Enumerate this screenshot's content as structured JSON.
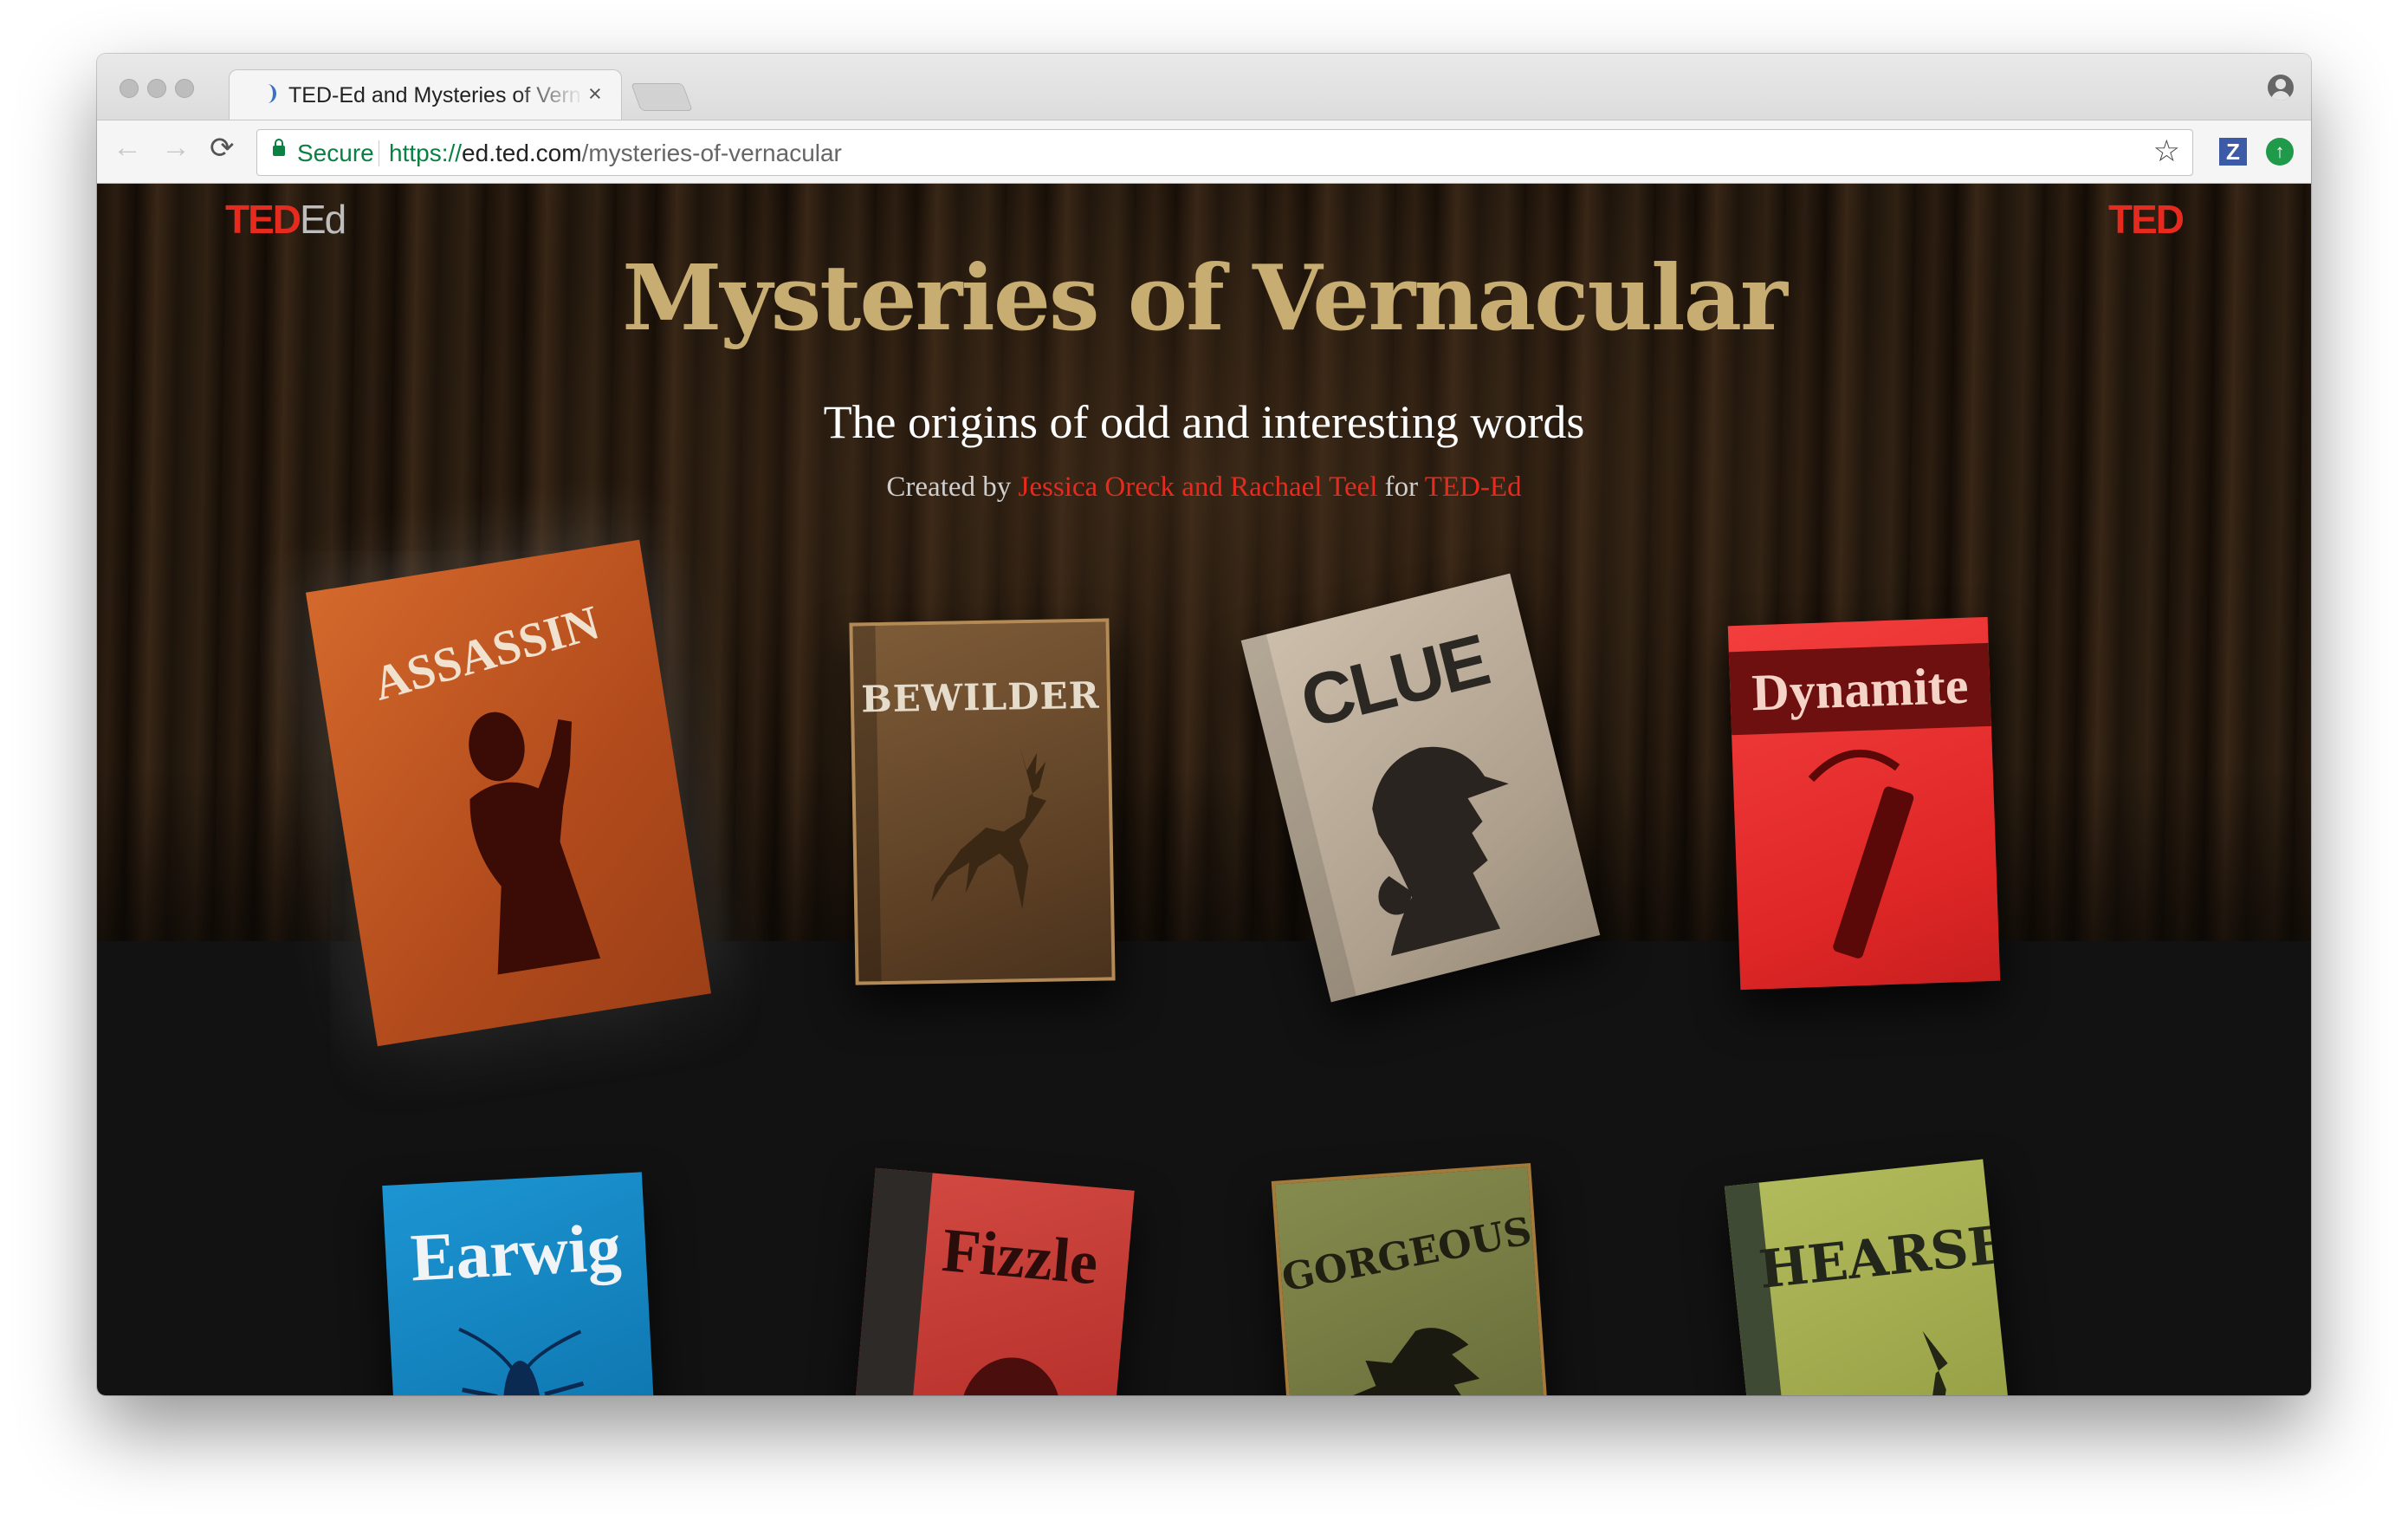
{
  "browser": {
    "tab_title": "TED-Ed and Mysteries of Vern",
    "close_glyph": "×",
    "nav": {
      "back": "←",
      "forward": "→",
      "reload": "⟳"
    },
    "omnibox": {
      "security_label": "Secure",
      "url_scheme": "https://",
      "url_host": "ed.ted.com",
      "url_path": "/mysteries-of-vernacular"
    },
    "bookmark_glyph": "☆",
    "extensions": {
      "z_label": "Z",
      "up_label": "↑"
    },
    "icons": [
      "back-arrow-icon",
      "forward-arrow-icon",
      "reload-icon",
      "lock-icon",
      "star-icon",
      "profile-icon",
      "loading-spinner-icon"
    ]
  },
  "page": {
    "logo_left": {
      "ted": "TED",
      "ed": "Ed"
    },
    "logo_right": "TED",
    "title": "Mysteries of Vernacular",
    "subtitle": "The origins of odd and interesting words",
    "credits": {
      "prefix": "Created by ",
      "authors": "Jessica Oreck and Rachael Teel",
      "middle": " for ",
      "org": "TED-Ed"
    },
    "colors": {
      "ted_red": "#e62b1e",
      "title_gold": "#c8ad72"
    }
  },
  "books": [
    {
      "word": "ASSASSIN",
      "cover_color": "#c85a23",
      "icon": "assassin-silhouette-icon"
    },
    {
      "word": "BEWILDER",
      "cover_color": "#6e4d2d",
      "icon": "leaping-deer-icon"
    },
    {
      "word": "CLUE",
      "cover_color": "#b8aa98",
      "icon": "detective-silhouette-icon"
    },
    {
      "word": "Dynamite",
      "cover_color": "#ea2f2f",
      "icon": "dynamite-stick-icon"
    },
    {
      "word": "Earwig",
      "cover_color": "#1684c0",
      "icon": "earwig-insect-icon"
    },
    {
      "word": "Fizzle",
      "cover_color": "#c93a34",
      "icon": "fizzle-silhouette-icon"
    },
    {
      "word": "GORGEOUS",
      "cover_color": "#7b7f45",
      "icon": "gorgon-silhouette-icon"
    },
    {
      "word": "HEARSE",
      "cover_color": "#a3ac52",
      "icon": "howling-wolf-icon"
    }
  ]
}
